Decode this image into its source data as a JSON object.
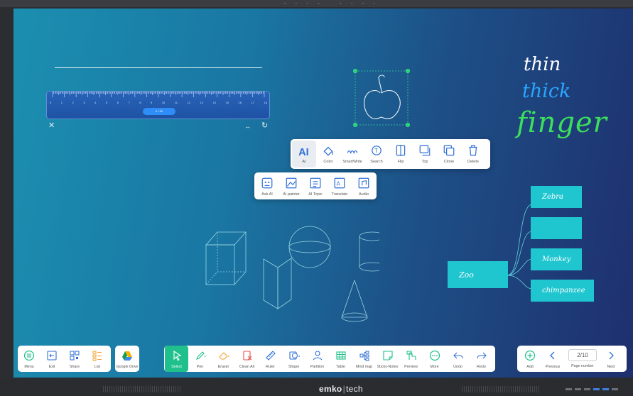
{
  "colors": {
    "accent_green": "#1fc08b",
    "mindmap_node": "#1fc6cf",
    "icon_blue": "#2f6fd6",
    "icon_orange": "#f2a233"
  },
  "ruler": {
    "numbers": [
      "0",
      "1",
      "2",
      "3",
      "4",
      "5",
      "6",
      "7",
      "8",
      "9",
      "10",
      "11",
      "12",
      "13",
      "14",
      "15",
      "16",
      "17",
      "18"
    ],
    "pill_text": "0 / 90"
  },
  "handwriting": {
    "thin": "thin",
    "thick": "thick",
    "finger": "finger"
  },
  "object_menu": {
    "items": [
      {
        "label": "AI",
        "icon": "ai-icon"
      },
      {
        "label": "Color",
        "icon": "paint-bucket-icon"
      },
      {
        "label": "SmartWrite",
        "icon": "smartwrite-icon"
      },
      {
        "label": "Search",
        "icon": "search-icon"
      },
      {
        "label": "Flip",
        "icon": "flip-icon"
      },
      {
        "label": "Top",
        "icon": "bring-to-top-icon"
      },
      {
        "label": "Clone",
        "icon": "clone-icon"
      },
      {
        "label": "Delete",
        "icon": "trash-icon"
      }
    ]
  },
  "ai_menu": {
    "items": [
      {
        "label": "Ask AI",
        "icon": "ask-ai-icon"
      },
      {
        "label": "AI painter",
        "icon": "ai-painter-icon"
      },
      {
        "label": "AI Topic",
        "icon": "ai-topic-icon"
      },
      {
        "label": "Translate",
        "icon": "translate-icon"
      },
      {
        "label": "Audio",
        "icon": "audio-icon"
      }
    ]
  },
  "mindmap": {
    "root": "Zoo",
    "children": [
      "Zebra",
      "",
      "Monkey",
      "chimpanzee"
    ]
  },
  "toolbar_left": {
    "items": [
      {
        "label": "Menu",
        "icon": "menu-icon"
      },
      {
        "label": "Exit",
        "icon": "exit-icon"
      },
      {
        "label": "Share",
        "icon": "qr-share-icon"
      },
      {
        "label": "List",
        "icon": "list-icon"
      }
    ],
    "google_drive": "Google Drive"
  },
  "toolbar_main": {
    "items": [
      {
        "label": "Select",
        "icon": "select-cursor-icon"
      },
      {
        "label": "Pen",
        "icon": "pen-icon"
      },
      {
        "label": "Eraser",
        "icon": "eraser-icon"
      },
      {
        "label": "Clean All",
        "icon": "clean-all-icon"
      },
      {
        "label": "Ruler",
        "icon": "ruler-icon"
      },
      {
        "label": "Shape",
        "icon": "shape-icon"
      },
      {
        "label": "Partition",
        "icon": "partition-icon"
      },
      {
        "label": "Table",
        "icon": "table-icon"
      },
      {
        "label": "Mind map",
        "icon": "mind-map-icon"
      },
      {
        "label": "Sticky-Notes",
        "icon": "sticky-notes-icon"
      },
      {
        "label": "Preview",
        "icon": "preview-icon"
      },
      {
        "label": "More",
        "icon": "more-icon"
      },
      {
        "label": "Undo",
        "icon": "undo-icon"
      },
      {
        "label": "Redo",
        "icon": "redo-icon"
      }
    ]
  },
  "toolbar_right": {
    "add": "Add",
    "previous": "Previous",
    "page_number_label": "Page number",
    "page_number": "2/10",
    "next": "Next"
  },
  "brand": {
    "name": "emko",
    "suffix": "tech"
  }
}
